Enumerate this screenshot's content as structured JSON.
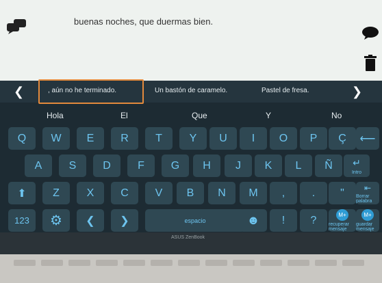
{
  "message": "buenas noches, que duermas bien.",
  "predictions": [
    ", aún no he terminado.",
    "Un bastón de caramelo.",
    "Pastel de fresa."
  ],
  "word_suggestions": [
    "Hola",
    "El",
    "Que",
    "Y",
    "No"
  ],
  "rows": {
    "row1": [
      "Q",
      "W",
      "E",
      "R",
      "T",
      "Y",
      "U",
      "I",
      "O",
      "P",
      "Ç"
    ],
    "row2": [
      "A",
      "S",
      "D",
      "F",
      "G",
      "H",
      "J",
      "K",
      "L",
      "Ñ"
    ],
    "row3": [
      "Z",
      "X",
      "C",
      "V",
      "B",
      "N",
      "M",
      ",",
      ".",
      "\""
    ]
  },
  "special": {
    "enter_label": "Intro",
    "delete_label": "Borrar palabra",
    "space_label": "espacio",
    "num_label": "123",
    "m1_label": "M+",
    "m1_caption": "recuperar mensaje",
    "m2_label": "M+",
    "m2_caption": "guardar mensaje",
    "exclaim": "!",
    "question": "?"
  },
  "brand": "ASUS ZenBook",
  "colors": {
    "accent": "#e48a3c",
    "key": "#2f4853",
    "key_text": "#6dc4ef"
  }
}
